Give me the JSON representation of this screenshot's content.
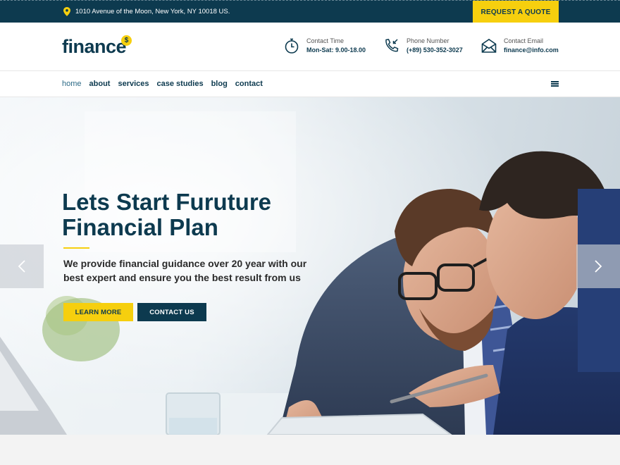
{
  "topbar": {
    "address": "1010 Avenue of the Moon, New York, NY 10018 US.",
    "quote_button": "REQUEST A QUOTE"
  },
  "header": {
    "logo_text": "finance",
    "logo_coin": "$",
    "contact_time": {
      "label": "Contact Time",
      "value": "Mon-Sat: 9.00-18.00",
      "icon": "clock-icon"
    },
    "phone": {
      "label": "Phone Number",
      "value": "(+89) 530-352-3027",
      "icon": "phone-icon"
    },
    "email": {
      "label": "Contact Email",
      "value": "finance@info.com",
      "icon": "envelope-icon"
    }
  },
  "nav": {
    "items": [
      {
        "label": "home",
        "active": true
      },
      {
        "label": "about",
        "active": false
      },
      {
        "label": "services",
        "active": false
      },
      {
        "label": "case studies",
        "active": false
      },
      {
        "label": "blog",
        "active": false
      },
      {
        "label": "contact",
        "active": false
      }
    ]
  },
  "hero": {
    "title": "Lets Start Furuture Financial Plan",
    "subtitle": "We provide financial guidance over 20 year with our best expert and ensure you the best result from us",
    "learn_button": "LEARN MORE",
    "contact_button": "CONTACT US"
  },
  "colors": {
    "primary": "#0d3a4f",
    "accent": "#f6cf0e",
    "light_bg": "#f4f4f4"
  }
}
